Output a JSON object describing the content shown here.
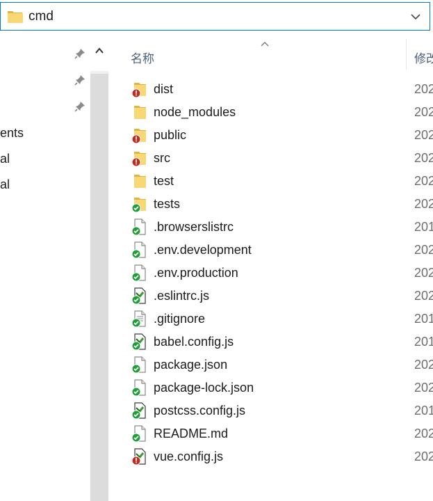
{
  "address_bar": {
    "path": "cmd",
    "folder_icon": "folder-icon",
    "dropdown_icon": "chevron-down-icon"
  },
  "nav_pane": {
    "items": [
      {
        "label": "ents"
      },
      {
        "label": "al"
      },
      {
        "label": "al"
      }
    ],
    "pin_icon": "pin-icon",
    "scroll_up_icon": "caret-up-icon"
  },
  "columns": {
    "name": "名称",
    "modified": "修改"
  },
  "files": [
    {
      "name": "dist",
      "date": "202",
      "icon": "folder-conflict-icon"
    },
    {
      "name": "node_modules",
      "date": "202",
      "icon": "folder-icon"
    },
    {
      "name": "public",
      "date": "202",
      "icon": "folder-conflict-icon"
    },
    {
      "name": "src",
      "date": "202",
      "icon": "folder-conflict-icon"
    },
    {
      "name": "test",
      "date": "202",
      "icon": "folder-icon"
    },
    {
      "name": "tests",
      "date": "202",
      "icon": "folder-synced-icon"
    },
    {
      "name": ".browserslistrc",
      "date": "201",
      "icon": "file-synced-icon"
    },
    {
      "name": ".env.development",
      "date": "202",
      "icon": "file-synced-icon"
    },
    {
      "name": ".env.production",
      "date": "202",
      "icon": "file-synced-icon"
    },
    {
      "name": ".eslintrc.js",
      "date": "202",
      "icon": "script-synced-icon"
    },
    {
      "name": ".gitignore",
      "date": "201",
      "icon": "text-file-synced-icon"
    },
    {
      "name": "babel.config.js",
      "date": "201",
      "icon": "script-synced-icon"
    },
    {
      "name": "package.json",
      "date": "202",
      "icon": "file-synced-icon"
    },
    {
      "name": "package-lock.json",
      "date": "202",
      "icon": "file-synced-icon"
    },
    {
      "name": "postcss.config.js",
      "date": "201",
      "icon": "script-synced-icon"
    },
    {
      "name": "README.md",
      "date": "202",
      "icon": "file-synced-icon"
    },
    {
      "name": "vue.config.js",
      "date": "202",
      "icon": "script-conflict-icon"
    }
  ],
  "colors": {
    "accent": "#0078d7",
    "folder": "#f8d775",
    "folder_dark": "#e0b440",
    "synced": "#1e9e38",
    "conflict": "#c42b1c",
    "header_text": "#4c607a"
  }
}
